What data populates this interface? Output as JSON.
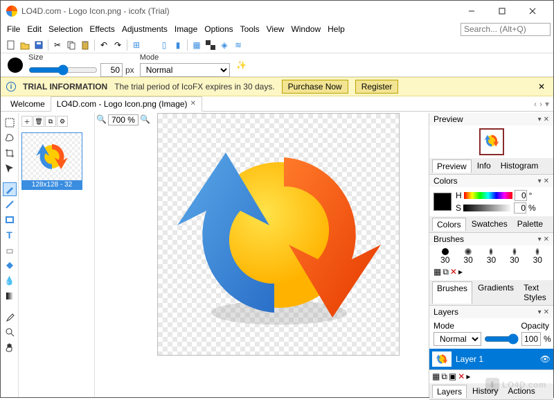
{
  "window": {
    "title": "LO4D.com - Logo Icon.png - icofx (Trial)"
  },
  "menu": [
    "File",
    "Edit",
    "Selection",
    "Effects",
    "Adjustments",
    "Image",
    "Options",
    "Tools",
    "View",
    "Window",
    "Help"
  ],
  "search": {
    "placeholder": "Search... (Alt+Q)"
  },
  "brushbar": {
    "size_label": "Size",
    "size_value": "50",
    "unit": "px",
    "mode_label": "Mode",
    "mode_value": "Normal"
  },
  "trial": {
    "heading": "TRIAL INFORMATION",
    "message": "The trial period of IcoFX expires in 30 days.",
    "purchase": "Purchase Now",
    "register": "Register"
  },
  "tabs": {
    "welcome": "Welcome",
    "doc": "LO4D.com - Logo Icon.png (Image)"
  },
  "zoom": {
    "value": "700 %"
  },
  "thumb": {
    "caption": "128x128 - 32"
  },
  "panels": {
    "preview": {
      "title": "Preview",
      "tabs": [
        "Preview",
        "Info",
        "Histogram"
      ]
    },
    "colors": {
      "title": "Colors",
      "tabs": [
        "Colors",
        "Swatches",
        "Palette"
      ],
      "h": "H",
      "s": "S",
      "val0": "0",
      "deg": "°",
      "pct": "%"
    },
    "brushes": {
      "title": "Brushes",
      "tabs": [
        "Brushes",
        "Gradients",
        "Text Styles"
      ],
      "sizes": [
        "30",
        "30",
        "30",
        "30",
        "30"
      ]
    },
    "layers": {
      "title": "Layers",
      "mode_label": "Mode",
      "opacity_label": "Opacity",
      "mode_value": "Normal",
      "opacity_value": "100",
      "opacity_unit": "%",
      "layer1": "Layer 1",
      "bottom_tabs": [
        "Layers",
        "History",
        "Actions"
      ]
    }
  },
  "watermark": "LO4D.com"
}
